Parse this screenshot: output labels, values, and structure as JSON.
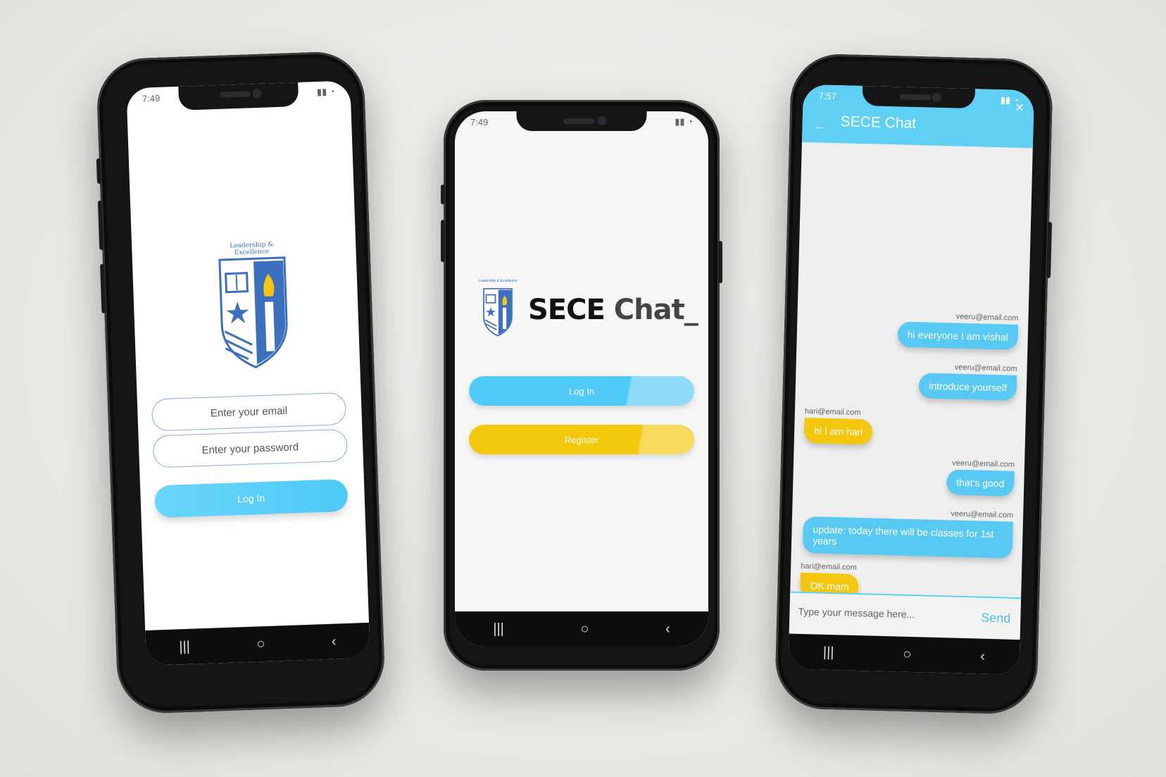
{
  "phones": {
    "login_screen": {
      "status_time": "7:49",
      "crest_text": "Leadership & Excellence",
      "email_placeholder": "Enter your email",
      "password_placeholder": "Enter your password",
      "login_button": "Log In",
      "nav": [
        "|||",
        "○",
        "‹"
      ]
    },
    "welcome_screen": {
      "status_time": "7:49",
      "crest_text": "Leadership & Excellence",
      "brand_part1": "SECE",
      "brand_part2": "Chat_",
      "login_button": "Log In",
      "register_button": "Register",
      "nav": [
        "|||",
        "○",
        "‹"
      ]
    },
    "chat_screen": {
      "status_time": "7:57",
      "title": "SECE Chat",
      "close_icon": "×",
      "back_icon": "←",
      "messages": [
        {
          "sender": "veeru@email.com",
          "text": "hi everyone I am vishal",
          "side": "right"
        },
        {
          "sender": "veeru@email.com",
          "text": "introduce yourself",
          "side": "right"
        },
        {
          "sender": "hari@email.com",
          "text": "hi I am hari",
          "side": "left"
        },
        {
          "sender": "veeru@email.com",
          "text": "that's good",
          "side": "right"
        },
        {
          "sender": "veeru@email.com",
          "text": "update: today there will be classes for 1st years",
          "side": "right"
        },
        {
          "sender": "hari@email.com",
          "text": "OK mam",
          "side": "left"
        }
      ],
      "message_placeholder": "Type your message here...",
      "send_button": "Send",
      "nav": [
        "|||",
        "○",
        "‹"
      ]
    }
  },
  "colors": {
    "accent_blue": "#57c9f2",
    "accent_yellow": "#f2c70e",
    "crest_blue": "#3d6fbf"
  }
}
